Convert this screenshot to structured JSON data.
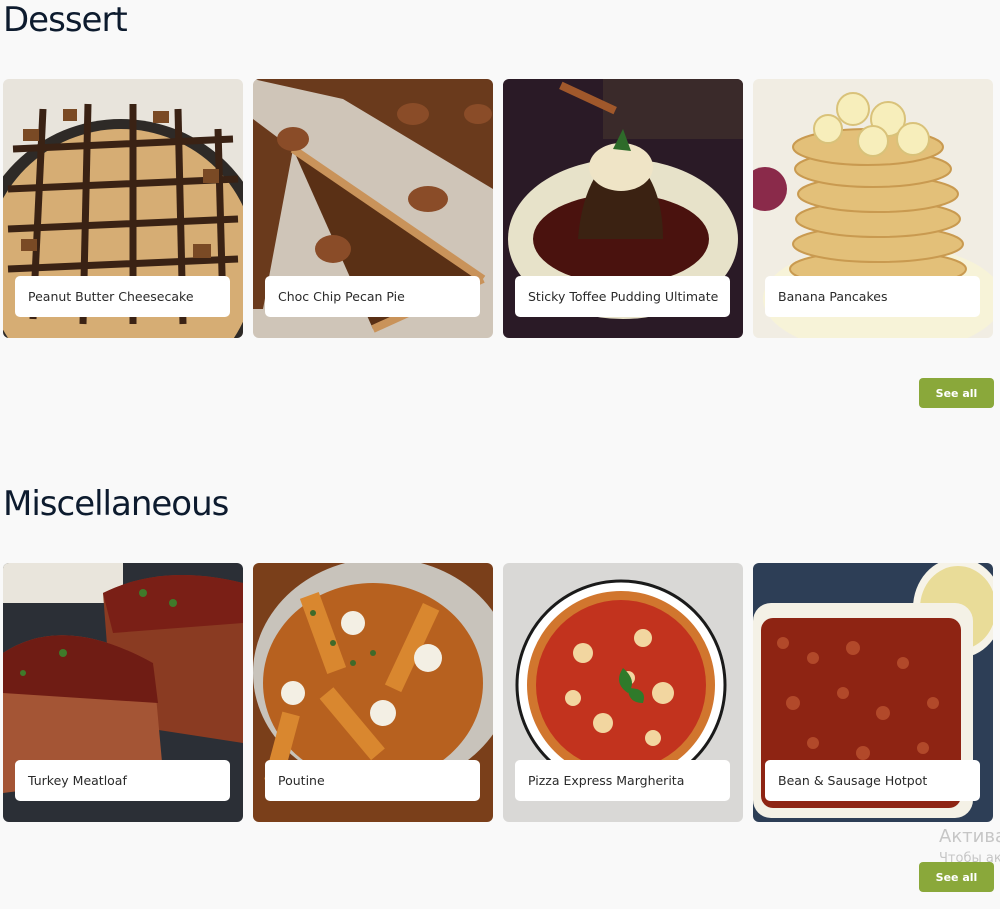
{
  "sections": [
    {
      "title": "Dessert",
      "see_all": "See all",
      "cards": [
        {
          "name": "Peanut Butter Cheesecake"
        },
        {
          "name": "Choc Chip Pecan Pie"
        },
        {
          "name": "Sticky Toffee Pudding Ultimate"
        },
        {
          "name": "Banana Pancakes"
        }
      ]
    },
    {
      "title": "Miscellaneous",
      "see_all": "See all",
      "cards": [
        {
          "name": "Turkey Meatloaf"
        },
        {
          "name": "Poutine"
        },
        {
          "name": "Pizza Express Margherita"
        },
        {
          "name": "Bean & Sausage Hotpot"
        }
      ]
    }
  ],
  "watermark": {
    "line1": "Актива",
    "line2": "Чтобы ак"
  }
}
